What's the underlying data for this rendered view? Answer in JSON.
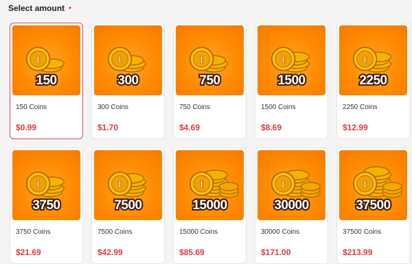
{
  "header": {
    "title": "Select amount",
    "required_mark": "•"
  },
  "packages": [
    {
      "amount": "150",
      "name": "150 Coins",
      "price": "$0.99",
      "selected": true,
      "coins": 2
    },
    {
      "amount": "300",
      "name": "300 Coins",
      "price": "$1.70",
      "selected": false,
      "coins": 3
    },
    {
      "amount": "750",
      "name": "750 Coins",
      "price": "$4.69",
      "selected": false,
      "coins": 3
    },
    {
      "amount": "1500",
      "name": "1500 Coins",
      "price": "$8.69",
      "selected": false,
      "coins": 4
    },
    {
      "amount": "2250",
      "name": "2250 Coins",
      "price": "$12.99",
      "selected": false,
      "coins": 4
    },
    {
      "amount": "3750",
      "name": "3750 Coins",
      "price": "$21.69",
      "selected": false,
      "coins": 4
    },
    {
      "amount": "7500",
      "name": "7500 Coins",
      "price": "$42.99",
      "selected": false,
      "coins": 5
    },
    {
      "amount": "15000",
      "name": "15000 Coins",
      "price": "$85.69",
      "selected": false,
      "coins": 6
    },
    {
      "amount": "30000",
      "name": "30000 Coins",
      "price": "$171.00",
      "selected": false,
      "coins": 6
    },
    {
      "amount": "37500",
      "name": "37500 Coins",
      "price": "$213.99",
      "selected": false,
      "coins": 7
    }
  ],
  "colors": {
    "tile": "#ff8a00",
    "price": "#e0393f",
    "selected_border": "#e0464f",
    "coin": "#f7b500"
  },
  "icons": {
    "coin": "coin-icon"
  }
}
